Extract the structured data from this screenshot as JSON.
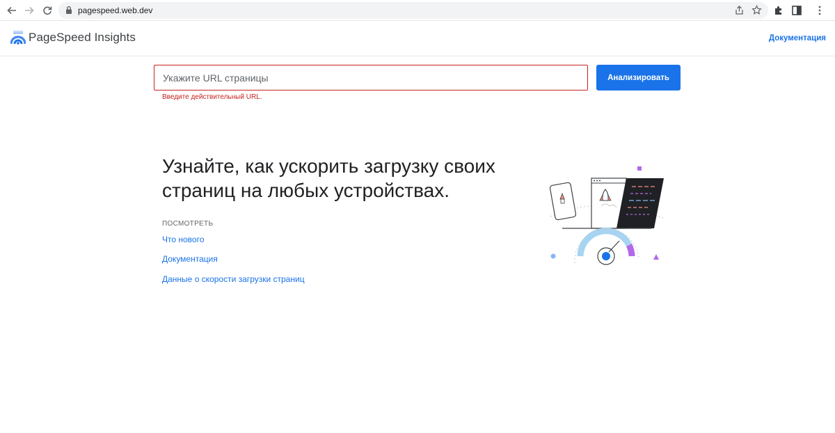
{
  "browser": {
    "url": "pagespeed.web.dev"
  },
  "header": {
    "logo_text": "PageSpeed Insights",
    "doc_link": "Документация"
  },
  "form": {
    "url_placeholder": "Укажите URL страницы",
    "url_value": "",
    "error": "Введите действительный URL.",
    "analyze_label": "Анализировать"
  },
  "hero": {
    "title": "Узнайте, как ускорить загрузку своих страниц на любых устройствах.",
    "see_label": "ПОСМОТРЕТЬ",
    "links": [
      {
        "label": "Что нового"
      },
      {
        "label": "Документация"
      },
      {
        "label": "Данные о скорости загрузки страниц"
      }
    ]
  },
  "colors": {
    "accent": "#1a73e8",
    "error": "#c5221f",
    "gauge_purple": "#b368e8",
    "gauge_light_blue": "#a6d4f2",
    "dark_panel": "#202124"
  },
  "icons": [
    "back-arrow-icon",
    "forward-arrow-icon",
    "reload-icon",
    "lock-icon",
    "share-icon",
    "star-icon",
    "extensions-icon",
    "side-panel-icon",
    "menu-icon",
    "pagespeed-logo-icon"
  ]
}
